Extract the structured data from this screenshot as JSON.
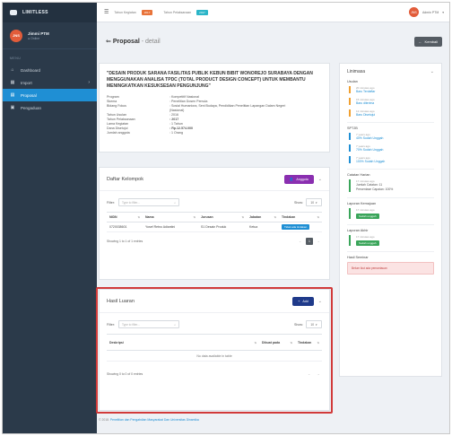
{
  "app": {
    "brand": "LIMITLESS"
  },
  "sidebar": {
    "user_initials": "JNS",
    "user_name": "Jimmi PTM",
    "user_status": "● Online",
    "section": "MENU",
    "items": [
      {
        "label": "Dashboard",
        "icon": "home-icon",
        "active": false
      },
      {
        "label": "Import",
        "icon": "import-icon",
        "active": false
      },
      {
        "label": "Proposal",
        "icon": "document-icon",
        "active": true
      },
      {
        "label": "Pengaduan",
        "icon": "doc-alert-icon",
        "active": false
      }
    ]
  },
  "topbar": {
    "badge1_label": "Tahun Kegiatan",
    "badge1_value": "2017",
    "badge2_label": "Tahun Pelaksanaan",
    "badge2_value": "2017",
    "user_initials": "JNS",
    "user_name": "Admin PTM"
  },
  "page": {
    "title": "Proposal",
    "subtitle": " - detail",
    "back_label": "Kembali"
  },
  "detail": {
    "title": "\"DESAIN PRODUK SARANA FASILITAS PUBLIK KEBUN BIBIT WONOREJO SURABAYA DENGAN MENGGUNAKAN ANALISA TPDC (TOTAL PRODUCT DESIGN CONCEPT) UNTUK MEMBANTU MENINGKATKAN KESUKSESAN PENGUNJUNG\"",
    "rows": [
      {
        "k": "Program",
        "v": ": Kompetitif Nasional"
      },
      {
        "k": "Skema",
        "v": ": Penelitian Dosen Pemula"
      },
      {
        "k": "Bidang Fokus",
        "v": ": Sosial Humaniora, Seni Budaya, Pendidikan Penelitian Lapangan Dalam Negeri"
      },
      {
        "k": "",
        "v": "(Nasional)"
      },
      {
        "k": "Tahun Usulan",
        "v": ": 2016"
      },
      {
        "k": "Tahun Pelaksanaan",
        "v": ": 2017"
      },
      {
        "k": "Lama Kegiatan",
        "v": ": 1 Tahun"
      },
      {
        "k": "Dana Disetujui",
        "v": ": Rp.12.574.000"
      },
      {
        "k": "Jumlah anggota",
        "v": ": 1 Orang"
      }
    ]
  },
  "kelompok": {
    "title": "Daftar Kelompok",
    "add_label": "Anggota",
    "filter_label": "Filter:",
    "filter_placeholder": "Type to filter...",
    "show_label": "Show:",
    "show_value": "10",
    "columns": [
      "NIDN",
      "Nama",
      "Jurusan",
      "Jabatan",
      "Tindakan"
    ],
    "rows": [
      {
        "nidn": "0720038601",
        "nama": "Yosef Retno Adiantini",
        "jurusan": "S1 Desain Produk",
        "jabatan": "Ketua",
        "tindakan": "Tidak ada tindakan"
      }
    ],
    "info": "Showing 1 to 1 of 1 entries",
    "page": "1"
  },
  "hasil": {
    "title": "Hasil Luaran",
    "add_label": "Add",
    "filter_label": "Filter:",
    "filter_placeholder": "Type to filter...",
    "show_label": "Show:",
    "show_value": "10",
    "columns": [
      "Deskripsi",
      "Dibuat pada",
      "Tindakan"
    ],
    "empty": "No data available in table",
    "info": "Showing 0 to 0 of 0 entries"
  },
  "timeline": {
    "title": "Linimasa",
    "groups": [
      {
        "title": "Usulan",
        "color": "#f0a030",
        "entries": [
          {
            "time": "20 minutes ago",
            "text": "Baru Terdaftar"
          },
          {
            "time": "15 minutes ago",
            "text": "Baru diterima"
          },
          {
            "time": "12 minutes ago",
            "text": "Baru Disetujui"
          }
        ]
      },
      {
        "title": "SPTJB",
        "color": "#1f8fd4",
        "entries": [
          {
            "time": "7 years ago",
            "text": "40% Sudah Unggah"
          },
          {
            "time": "7 years ago",
            "text": "70% Sudah Unggah"
          },
          {
            "time": "7 years ago",
            "text": "100% Sudah Unggah"
          }
        ]
      }
    ],
    "catatan_title": "Catatan Harian",
    "catatan_time": "17 minutes ago",
    "catatan_lines": [
      "Jumlah Catatan: 11",
      "Persentase Capaian: 100%"
    ],
    "kemajuan_title": "Laporan Kemajuan",
    "kemajuan_time": "17 minutes ago",
    "kemajuan_badge": "Sudah unggah",
    "akhir_title": "Laporan Akhir",
    "akhir_time": "17 minutes ago",
    "akhir_badge": "Sudah unggah",
    "seminar_title": "Hasil Seminar",
    "seminar_alert": "Belum ikut ada pemantauan"
  },
  "footer": {
    "prefix": "© 2018. ",
    "link": "Penelitian dan Pengabdian Masyarakat Dan Universitas Dinamika"
  },
  "colors": {
    "sidebar": "#2b3a4a",
    "accent_blue": "#1f8fd4",
    "accent_purple": "#8a2fb0",
    "accent_navy": "#1f3a8a",
    "highlight_red": "#d13a3a"
  }
}
